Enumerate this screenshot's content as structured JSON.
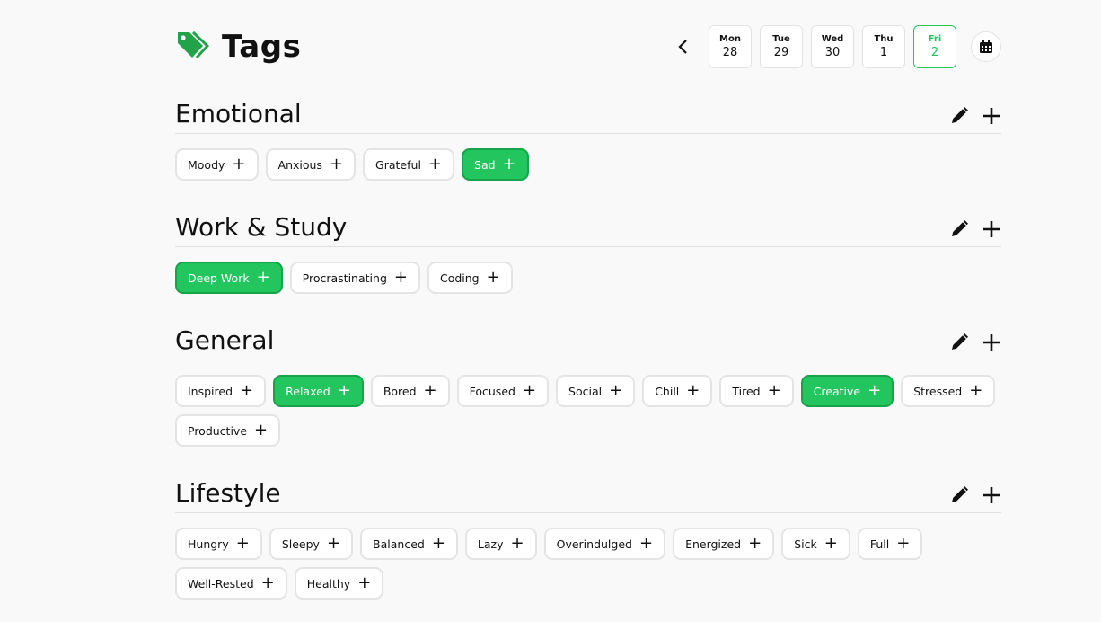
{
  "header": {
    "title": "Tags"
  },
  "dates": [
    {
      "day": "Mon",
      "date": "28",
      "active": false
    },
    {
      "day": "Tue",
      "date": "29",
      "active": false
    },
    {
      "day": "Wed",
      "date": "30",
      "active": false
    },
    {
      "day": "Thu",
      "date": "1",
      "active": false
    },
    {
      "day": "Fri",
      "date": "2",
      "active": true
    }
  ],
  "sections": [
    {
      "title": "Emotional",
      "tags": [
        {
          "label": "Moody",
          "selected": false
        },
        {
          "label": "Anxious",
          "selected": false
        },
        {
          "label": "Grateful",
          "selected": false
        },
        {
          "label": "Sad",
          "selected": true
        }
      ]
    },
    {
      "title": "Work & Study",
      "tags": [
        {
          "label": "Deep Work",
          "selected": true
        },
        {
          "label": "Procrastinating",
          "selected": false
        },
        {
          "label": "Coding",
          "selected": false
        }
      ]
    },
    {
      "title": "General",
      "tags": [
        {
          "label": "Inspired",
          "selected": false
        },
        {
          "label": "Relaxed",
          "selected": true
        },
        {
          "label": "Bored",
          "selected": false
        },
        {
          "label": "Focused",
          "selected": false
        },
        {
          "label": "Social",
          "selected": false
        },
        {
          "label": "Chill",
          "selected": false
        },
        {
          "label": "Tired",
          "selected": false
        },
        {
          "label": "Creative",
          "selected": true
        },
        {
          "label": "Stressed",
          "selected": false
        },
        {
          "label": "Productive",
          "selected": false
        }
      ]
    },
    {
      "title": "Lifestyle",
      "tags": [
        {
          "label": "Hungry",
          "selected": false
        },
        {
          "label": "Sleepy",
          "selected": false
        },
        {
          "label": "Balanced",
          "selected": false
        },
        {
          "label": "Lazy",
          "selected": false
        },
        {
          "label": "Overindulged",
          "selected": false
        },
        {
          "label": "Energized",
          "selected": false
        },
        {
          "label": "Sick",
          "selected": false
        },
        {
          "label": "Full",
          "selected": false
        },
        {
          "label": "Well-Rested",
          "selected": false
        },
        {
          "label": "Healthy",
          "selected": false
        }
      ]
    }
  ],
  "icons": {
    "brand": "tags-icon",
    "prev": "chevron-left-icon",
    "calendar": "calendar-icon",
    "edit": "pencil-icon",
    "add": "plus-icon"
  },
  "colors": {
    "accent": "#22c55e"
  }
}
